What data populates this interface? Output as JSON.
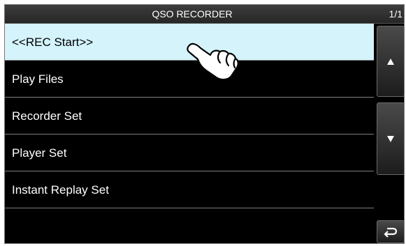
{
  "header": {
    "title": "QSO RECORDER",
    "page": "1/1"
  },
  "menu": {
    "items": [
      {
        "label": "<<REC Start>>",
        "selected": true
      },
      {
        "label": "Play Files"
      },
      {
        "label": "Recorder Set"
      },
      {
        "label": "Player Set"
      },
      {
        "label": "Instant Replay Set"
      }
    ]
  },
  "icons": {
    "scroll_up": "triangle-up-icon",
    "scroll_down": "triangle-down-icon",
    "back": "return-arrow-icon",
    "pointer": "pointing-hand-icon"
  },
  "colors": {
    "selected_row": "#d4f3fb",
    "background": "#000000",
    "text": "#ffffff"
  }
}
